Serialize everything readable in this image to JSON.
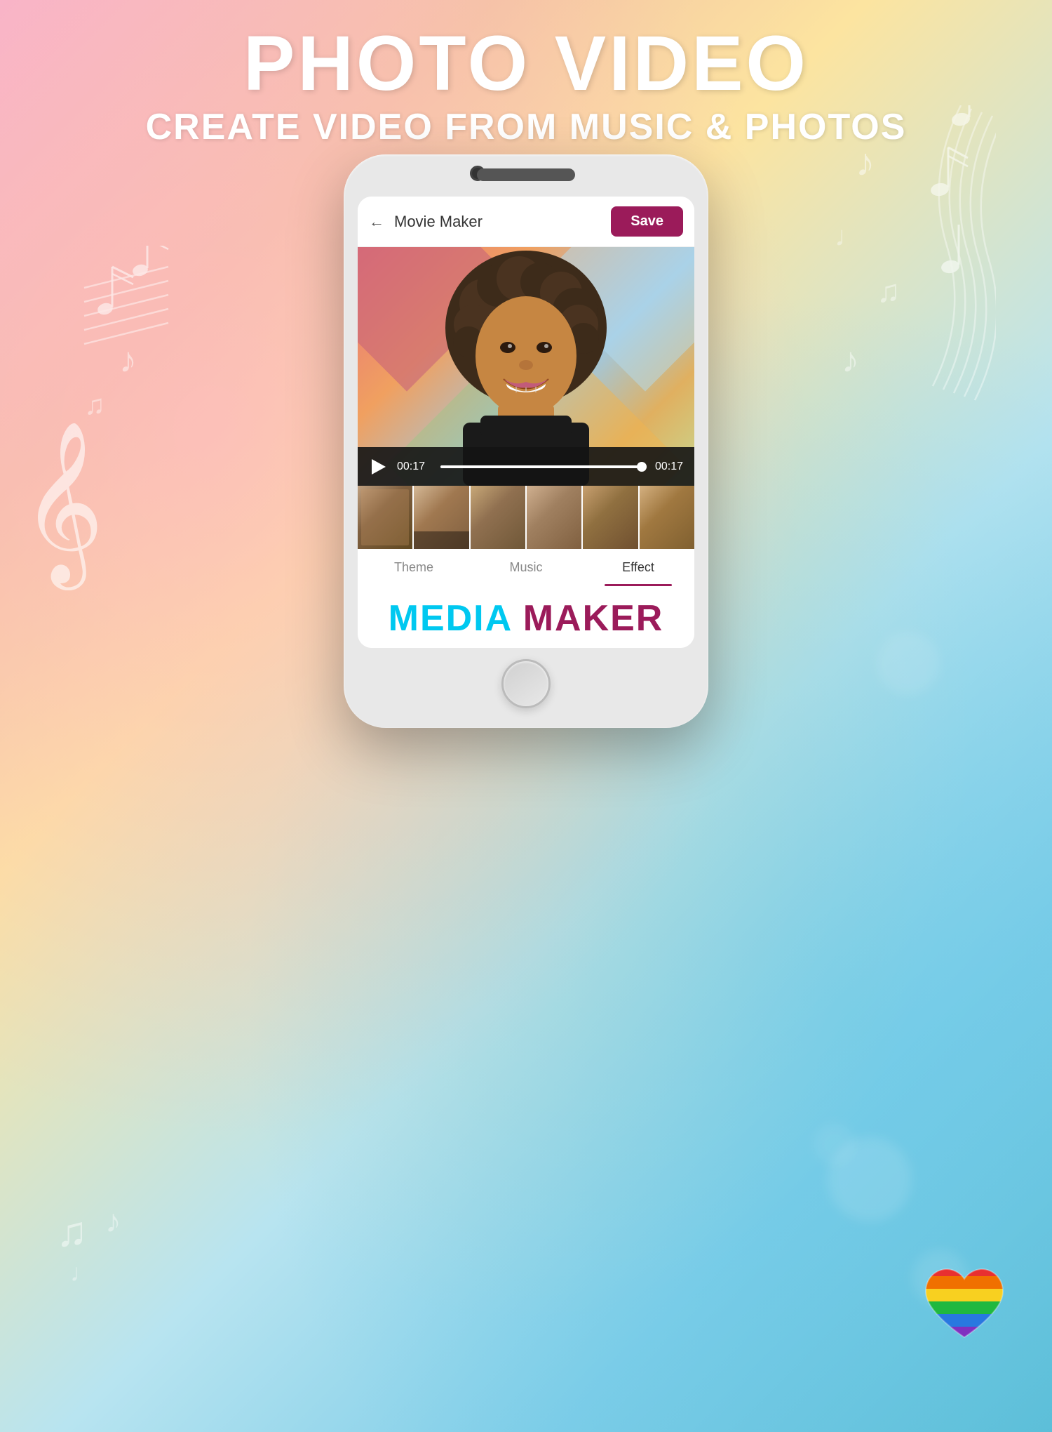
{
  "background": {
    "gradient_desc": "pink to peach to yellow to blue gradient"
  },
  "title": {
    "main": "PHOTO VIDEO",
    "subtitle": "CREATE VIDEO FROM MUSIC & PHOTOS"
  },
  "phone": {
    "header": {
      "back_label": "←",
      "title": "Movie Maker",
      "save_label": "Save"
    },
    "video": {
      "time_current": "00:17",
      "time_total": "00:17",
      "progress_pct": 100
    },
    "tabs": [
      {
        "id": "theme",
        "label": "Theme",
        "active": false
      },
      {
        "id": "music",
        "label": "Music",
        "active": false
      },
      {
        "id": "effect",
        "label": "Effect",
        "active": true
      }
    ],
    "brand": {
      "word1": "MEDIA",
      "word2": "MAKER",
      "word1_color": "#00c8f0",
      "word2_color": "#9b1b5a"
    }
  },
  "thumbnails": [
    "thumb1",
    "thumb2",
    "thumb3",
    "thumb4",
    "thumb5",
    "thumb6"
  ],
  "icons": {
    "back": "←",
    "play": "▶",
    "home": "○",
    "treble_clef": "𝄞",
    "music_note": "♪",
    "music_note2": "♫"
  }
}
